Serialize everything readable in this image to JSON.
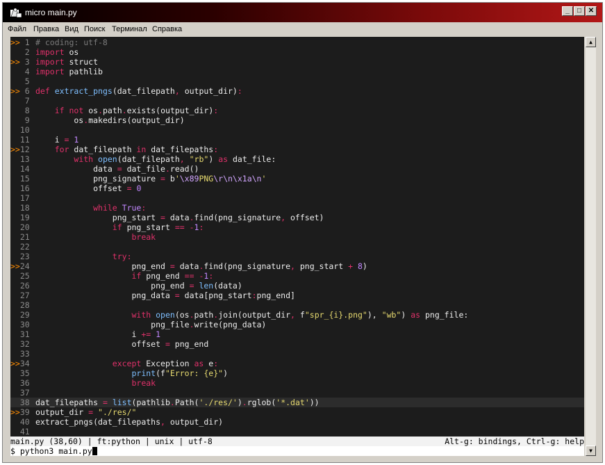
{
  "window": {
    "title": "micro main.py",
    "icon": "terminal-app-icon",
    "controls": {
      "minimize": "_",
      "maximize": "□",
      "close": "✕"
    }
  },
  "menu": [
    "Файл",
    "Правка",
    "Вид",
    "Поиск",
    "Терминал",
    "Справка"
  ],
  "colors": {
    "background": "#1c1c1c",
    "keyword": "#e0316a",
    "function": "#7fbfff",
    "string": "#e6d96f",
    "number": "#c288ff",
    "comment": "#7a7a7a",
    "gutter_marker": "#ff8c00"
  },
  "code": [
    {
      "n": "1",
      "m": ">>",
      "t": [
        [
          "cm",
          "# coding: utf-8"
        ]
      ]
    },
    {
      "n": "2",
      "t": [
        [
          "kw",
          "import"
        ],
        [
          "tx",
          " os"
        ]
      ]
    },
    {
      "n": "3",
      "m": ">>",
      "t": [
        [
          "kw",
          "import"
        ],
        [
          "tx",
          " struct"
        ]
      ]
    },
    {
      "n": "4",
      "t": [
        [
          "kw",
          "import"
        ],
        [
          "tx",
          " pathlib"
        ]
      ]
    },
    {
      "n": "5",
      "t": []
    },
    {
      "n": "6",
      "m": ">>",
      "t": [
        [
          "kw",
          "def"
        ],
        [
          "tx",
          " "
        ],
        [
          "fn",
          "extract_pngs"
        ],
        [
          "tx",
          "(dat_filepath"
        ],
        [
          "pun",
          ","
        ],
        [
          "tx",
          " output_dir)"
        ],
        [
          "pun",
          ":"
        ]
      ]
    },
    {
      "n": "7",
      "t": []
    },
    {
      "n": "8",
      "t": [
        [
          "tx",
          "    "
        ],
        [
          "kw",
          "if"
        ],
        [
          "tx",
          " "
        ],
        [
          "kw",
          "not"
        ],
        [
          "tx",
          " os"
        ],
        [
          "pun",
          "."
        ],
        [
          "tx",
          "path"
        ],
        [
          "pun",
          "."
        ],
        [
          "tx",
          "exists(output_dir)"
        ],
        [
          "pun",
          ":"
        ]
      ]
    },
    {
      "n": "9",
      "t": [
        [
          "tx",
          "        os"
        ],
        [
          "pun",
          "."
        ],
        [
          "tx",
          "makedirs(output_dir)"
        ]
      ]
    },
    {
      "n": "10",
      "t": []
    },
    {
      "n": "11",
      "t": [
        [
          "tx",
          "    i "
        ],
        [
          "op",
          "="
        ],
        [
          "tx",
          " "
        ],
        [
          "num",
          "1"
        ]
      ]
    },
    {
      "n": "12",
      "m": ">>",
      "t": [
        [
          "tx",
          "    "
        ],
        [
          "kw",
          "for"
        ],
        [
          "tx",
          " dat_filepath "
        ],
        [
          "kw",
          "in"
        ],
        [
          "tx",
          " dat_filepaths"
        ],
        [
          "pun",
          ":"
        ]
      ]
    },
    {
      "n": "13",
      "t": [
        [
          "tx",
          "        "
        ],
        [
          "kw",
          "with"
        ],
        [
          "tx",
          " "
        ],
        [
          "bi",
          "open"
        ],
        [
          "tx",
          "(dat_filepath"
        ],
        [
          "pun",
          ","
        ],
        [
          "tx",
          " "
        ],
        [
          "str",
          "\"rb\""
        ],
        [
          "tx",
          ") "
        ],
        [
          "kw",
          "as"
        ],
        [
          "tx",
          " dat_file:"
        ]
      ]
    },
    {
      "n": "14",
      "t": [
        [
          "tx",
          "            data "
        ],
        [
          "op",
          "="
        ],
        [
          "tx",
          " dat_file"
        ],
        [
          "pun",
          "."
        ],
        [
          "tx",
          "read()"
        ]
      ]
    },
    {
      "n": "15",
      "t": [
        [
          "tx",
          "            png_signature "
        ],
        [
          "op",
          "="
        ],
        [
          "tx",
          " b"
        ],
        [
          "str",
          "'"
        ],
        [
          "esc",
          "\\x89"
        ],
        [
          "str",
          "PNG"
        ],
        [
          "esc",
          "\\r\\n\\x1a\\n"
        ],
        [
          "str",
          "'"
        ]
      ]
    },
    {
      "n": "16",
      "t": [
        [
          "tx",
          "            offset "
        ],
        [
          "op",
          "="
        ],
        [
          "tx",
          " "
        ],
        [
          "num",
          "0"
        ]
      ]
    },
    {
      "n": "17",
      "t": []
    },
    {
      "n": "18",
      "t": [
        [
          "tx",
          "            "
        ],
        [
          "kw",
          "while"
        ],
        [
          "tx",
          " "
        ],
        [
          "cn",
          "True"
        ],
        [
          "pun",
          ":"
        ]
      ]
    },
    {
      "n": "19",
      "t": [
        [
          "tx",
          "                png_start "
        ],
        [
          "op",
          "="
        ],
        [
          "tx",
          " data"
        ],
        [
          "pun",
          "."
        ],
        [
          "tx",
          "find(png_signature"
        ],
        [
          "pun",
          ","
        ],
        [
          "tx",
          " offset)"
        ]
      ]
    },
    {
      "n": "20",
      "t": [
        [
          "tx",
          "                "
        ],
        [
          "kw",
          "if"
        ],
        [
          "tx",
          " png_start "
        ],
        [
          "op",
          "=="
        ],
        [
          "tx",
          " "
        ],
        [
          "op",
          "-"
        ],
        [
          "num",
          "1"
        ],
        [
          "pun",
          ":"
        ]
      ]
    },
    {
      "n": "21",
      "t": [
        [
          "tx",
          "                    "
        ],
        [
          "kw",
          "break"
        ]
      ]
    },
    {
      "n": "22",
      "t": []
    },
    {
      "n": "23",
      "t": [
        [
          "tx",
          "                "
        ],
        [
          "kw",
          "try"
        ],
        [
          "pun",
          ":"
        ]
      ]
    },
    {
      "n": "24",
      "m": ">>",
      "t": [
        [
          "tx",
          "                    png_end "
        ],
        [
          "op",
          "="
        ],
        [
          "tx",
          " data"
        ],
        [
          "pun",
          "."
        ],
        [
          "tx",
          "find(png_signature"
        ],
        [
          "pun",
          ","
        ],
        [
          "tx",
          " png_start "
        ],
        [
          "op",
          "+"
        ],
        [
          "tx",
          " "
        ],
        [
          "num",
          "8"
        ],
        [
          "tx",
          ")"
        ]
      ]
    },
    {
      "n": "25",
      "t": [
        [
          "tx",
          "                    "
        ],
        [
          "kw",
          "if"
        ],
        [
          "tx",
          " png_end "
        ],
        [
          "op",
          "=="
        ],
        [
          "tx",
          " "
        ],
        [
          "op",
          "-"
        ],
        [
          "num",
          "1"
        ],
        [
          "pun",
          ":"
        ]
      ]
    },
    {
      "n": "26",
      "t": [
        [
          "tx",
          "                        png_end "
        ],
        [
          "op",
          "="
        ],
        [
          "tx",
          " "
        ],
        [
          "bi",
          "len"
        ],
        [
          "tx",
          "(data)"
        ]
      ]
    },
    {
      "n": "27",
      "t": [
        [
          "tx",
          "                    png_data "
        ],
        [
          "op",
          "="
        ],
        [
          "tx",
          " data[png_start"
        ],
        [
          "pun",
          ":"
        ],
        [
          "tx",
          "png_end]"
        ]
      ]
    },
    {
      "n": "28",
      "t": []
    },
    {
      "n": "29",
      "t": [
        [
          "tx",
          "                    "
        ],
        [
          "kw",
          "with"
        ],
        [
          "tx",
          " "
        ],
        [
          "bi",
          "open"
        ],
        [
          "tx",
          "(os"
        ],
        [
          "pun",
          "."
        ],
        [
          "tx",
          "path"
        ],
        [
          "pun",
          "."
        ],
        [
          "tx",
          "join(output_dir"
        ],
        [
          "pun",
          ","
        ],
        [
          "tx",
          " f"
        ],
        [
          "str",
          "\"spr_{i}.png\""
        ],
        [
          "tx",
          "), "
        ],
        [
          "str",
          "\"wb\""
        ],
        [
          "tx",
          ") "
        ],
        [
          "kw",
          "as"
        ],
        [
          "tx",
          " png_file:"
        ]
      ]
    },
    {
      "n": "30",
      "t": [
        [
          "tx",
          "                        png_file"
        ],
        [
          "pun",
          "."
        ],
        [
          "tx",
          "write(png_data)"
        ]
      ]
    },
    {
      "n": "31",
      "t": [
        [
          "tx",
          "                    i "
        ],
        [
          "op",
          "+="
        ],
        [
          "tx",
          " "
        ],
        [
          "num",
          "1"
        ]
      ]
    },
    {
      "n": "32",
      "t": [
        [
          "tx",
          "                    offset "
        ],
        [
          "op",
          "="
        ],
        [
          "tx",
          " png_end"
        ]
      ]
    },
    {
      "n": "33",
      "t": []
    },
    {
      "n": "34",
      "m": ">>",
      "t": [
        [
          "tx",
          "                "
        ],
        [
          "kw",
          "except"
        ],
        [
          "tx",
          " Exception "
        ],
        [
          "kw",
          "as"
        ],
        [
          "tx",
          " e"
        ],
        [
          "pun",
          ":"
        ]
      ]
    },
    {
      "n": "35",
      "t": [
        [
          "tx",
          "                    "
        ],
        [
          "bi",
          "print"
        ],
        [
          "tx",
          "(f"
        ],
        [
          "str",
          "\"Error: {e}\""
        ],
        [
          "tx",
          ")"
        ]
      ]
    },
    {
      "n": "36",
      "t": [
        [
          "tx",
          "                    "
        ],
        [
          "kw",
          "break"
        ]
      ]
    },
    {
      "n": "37",
      "t": []
    },
    {
      "n": "38",
      "current": true,
      "t": [
        [
          "tx",
          "dat_filepaths "
        ],
        [
          "op",
          "="
        ],
        [
          "tx",
          " "
        ],
        [
          "bi",
          "list"
        ],
        [
          "tx",
          "(pathlib"
        ],
        [
          "pun",
          "."
        ],
        [
          "tx",
          "Path("
        ],
        [
          "str",
          "'./res/'"
        ],
        [
          "tx",
          ")"
        ],
        [
          "pun",
          "."
        ],
        [
          "tx",
          "rglob("
        ],
        [
          "str",
          "'*.dat'"
        ],
        [
          "tx",
          "))"
        ]
      ]
    },
    {
      "n": "39",
      "m": ">>",
      "t": [
        [
          "tx",
          "output_dir "
        ],
        [
          "op",
          "="
        ],
        [
          "tx",
          " "
        ],
        [
          "str",
          "\"./res/\""
        ]
      ]
    },
    {
      "n": "40",
      "t": [
        [
          "tx",
          "extract_pngs(dat_filepaths"
        ],
        [
          "pun",
          ","
        ],
        [
          "tx",
          " output_dir)"
        ]
      ]
    },
    {
      "n": "41",
      "t": []
    }
  ],
  "status": {
    "left": "main.py (38,60) | ft:python | unix | utf-8",
    "right": "Alt-g: bindings, Ctrl-g: help"
  },
  "shell": {
    "prompt": "$ python3 main.py"
  },
  "scrollbar": {
    "up": "▲",
    "down": "▼"
  }
}
